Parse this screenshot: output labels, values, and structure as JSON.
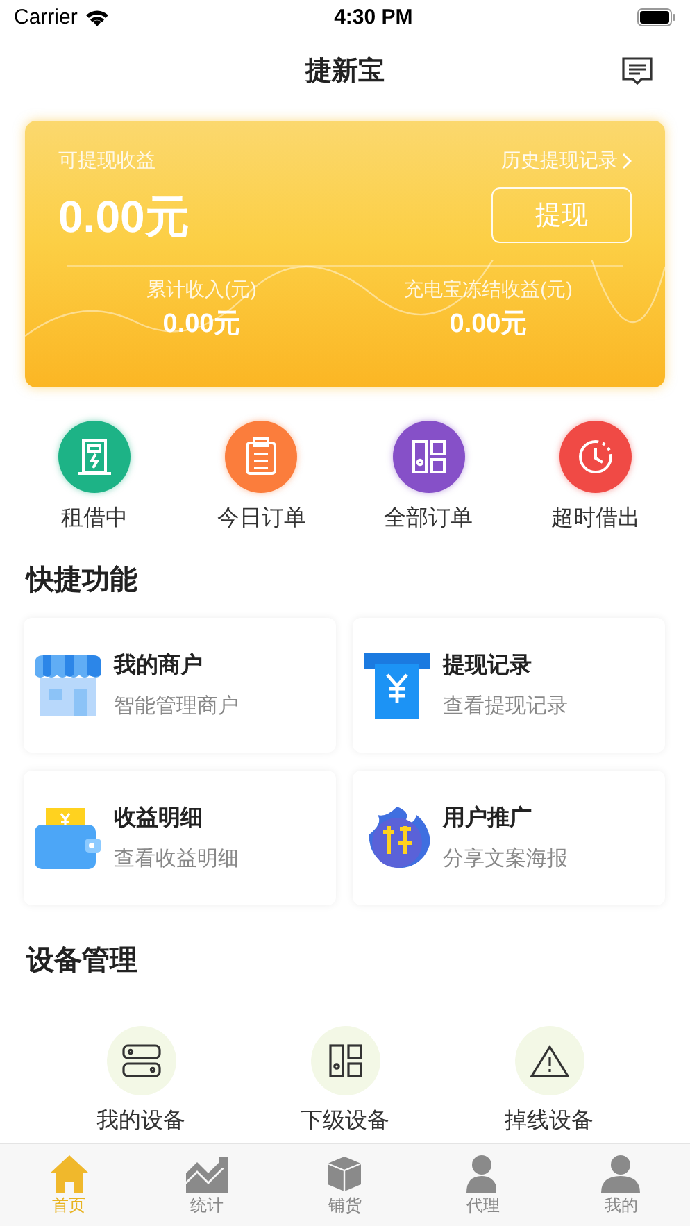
{
  "status_bar": {
    "carrier": "Carrier",
    "time": "4:30 PM"
  },
  "nav": {
    "title": "捷新宝"
  },
  "earnings": {
    "label": "可提现收益",
    "amount": "0.00元",
    "history_link": "历史提现记录",
    "withdraw_button": "提现",
    "stats": [
      {
        "label": "累计收入(元)",
        "value": "0.00元"
      },
      {
        "label": "充电宝冻结收益(元)",
        "value": "0.00元"
      }
    ]
  },
  "shortcuts": [
    {
      "label": "租借中",
      "kind": "cabinet",
      "color": "#1db386"
    },
    {
      "label": "今日订单",
      "kind": "clipboard",
      "color": "#fb7d3c"
    },
    {
      "label": "全部订单",
      "kind": "grid",
      "color": "#8650c8"
    },
    {
      "label": "超时借出",
      "kind": "clock",
      "color": "#f04a45"
    }
  ],
  "quick_functions": {
    "title": "快捷功能",
    "items": [
      {
        "title": "我的商户",
        "subtitle": "智能管理商户",
        "kind": "shop"
      },
      {
        "title": "提现记录",
        "subtitle": "查看提现记录",
        "kind": "receipt"
      },
      {
        "title": "收益明细",
        "subtitle": "查看收益明细",
        "kind": "wallet"
      },
      {
        "title": "用户推广",
        "subtitle": "分享文案海报",
        "kind": "promo"
      }
    ]
  },
  "devices": {
    "title": "设备管理",
    "items": [
      {
        "label": "我的设备",
        "kind": "stack"
      },
      {
        "label": "下级设备",
        "kind": "grid"
      },
      {
        "label": "掉线设备",
        "kind": "warning"
      }
    ]
  },
  "tabs": [
    {
      "label": "首页",
      "kind": "home",
      "selected": true
    },
    {
      "label": "统计",
      "kind": "chart",
      "selected": false
    },
    {
      "label": "铺货",
      "kind": "box",
      "selected": false
    },
    {
      "label": "代理",
      "kind": "agent",
      "selected": false
    },
    {
      "label": "我的",
      "kind": "person",
      "selected": false
    }
  ]
}
